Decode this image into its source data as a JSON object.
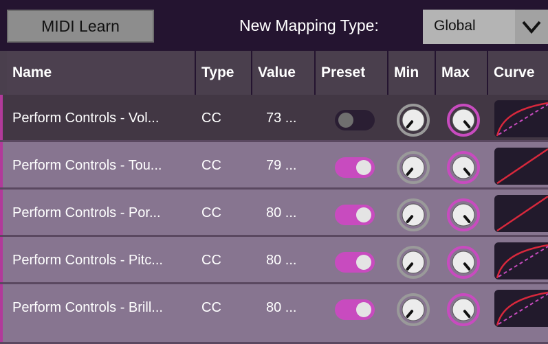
{
  "toolbar": {
    "midi_learn_label": "MIDI Learn",
    "new_mapping_label": "New Mapping Type:",
    "mapping_type_value": "Global"
  },
  "table": {
    "headers": {
      "name": "Name",
      "type": "Type",
      "value": "Value",
      "preset": "Preset",
      "min": "Min",
      "max": "Max",
      "curve": "Curve"
    },
    "rows": [
      {
        "name": "Perform Controls - Vol...",
        "type": "CC",
        "value": "73 ...",
        "preset": false,
        "curve": "log-dashed"
      },
      {
        "name": "Perform Controls - Tou...",
        "type": "CC",
        "value": "79 ...",
        "preset": true,
        "curve": "linear"
      },
      {
        "name": "Perform Controls - Por...",
        "type": "CC",
        "value": "80 ...",
        "preset": true,
        "curve": "linear"
      },
      {
        "name": "Perform Controls - Pitc...",
        "type": "CC",
        "value": "80 ...",
        "preset": true,
        "curve": "log-dashed"
      },
      {
        "name": "Perform Controls - Brill...",
        "type": "CC",
        "value": "80 ...",
        "preset": true,
        "curve": "log-dashed"
      }
    ]
  },
  "colors": {
    "accent": "#c84bbf",
    "background": "#241430",
    "row_alt": "#877590",
    "curve_line": "#d8283c",
    "curve_dash": "#c84bbf"
  },
  "icons": {
    "dropdown": "chevron-down-icon",
    "min_knob": "min-knob-icon",
    "max_knob": "max-knob-icon",
    "toggle": "toggle-switch"
  }
}
